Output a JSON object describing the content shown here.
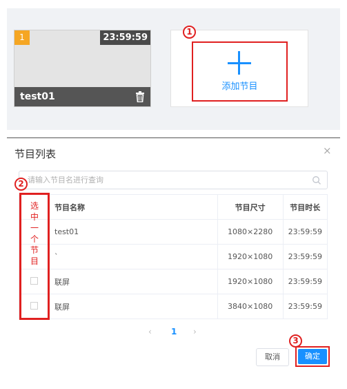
{
  "program_card": {
    "index": "1",
    "duration": "23:59:59",
    "name": "test01"
  },
  "add_program": {
    "label": "添加节目"
  },
  "annotations": {
    "step1": "1",
    "step2": "2",
    "step3": "3",
    "select_hint": "选中一个节目"
  },
  "dialog": {
    "title": "节目列表",
    "close": "×",
    "search_placeholder": "请输入节目名进行查询",
    "columns": {
      "name": "节目名称",
      "size": "节目尺寸",
      "duration": "节目时长"
    },
    "rows": [
      {
        "name": "test01",
        "size": "1080×2280",
        "duration": "23:59:59"
      },
      {
        "name": "`",
        "size": "1920×1080",
        "duration": "23:59:59"
      },
      {
        "name": "联屏",
        "size": "1920×1080",
        "duration": "23:59:59"
      },
      {
        "name": "联屏",
        "size": "3840×1080",
        "duration": "23:59:59"
      }
    ],
    "pagination": {
      "prev": "‹",
      "page": "1",
      "next": "›"
    },
    "cancel_label": "取消",
    "confirm_label": "确定"
  },
  "colors": {
    "accent": "#1890ff",
    "highlight": "#e02020",
    "badge": "#f5a623"
  }
}
